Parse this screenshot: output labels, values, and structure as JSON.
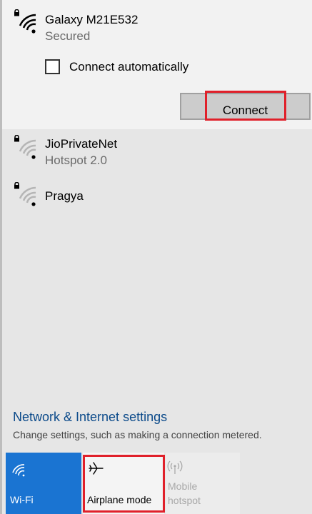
{
  "networks": [
    {
      "name": "Galaxy M21E532",
      "status": "Secured",
      "icon": "wifi-secured-icon"
    },
    {
      "name": "JioPrivateNet",
      "status": "Hotspot 2.0",
      "icon": "wifi-secured-icon"
    },
    {
      "name": "Pragya",
      "status": "",
      "icon": "wifi-secured-icon"
    }
  ],
  "connect_auto_label": "Connect automatically",
  "connect_auto_checked": false,
  "connect_button_label": "Connect",
  "settings": {
    "link": "Network & Internet settings",
    "description": "Change settings, such as making a connection metered."
  },
  "quick_actions": [
    {
      "label": "Wi-Fi",
      "icon": "wifi-icon",
      "state": "on"
    },
    {
      "label": "Airplane mode",
      "icon": "airplane-icon",
      "state": "off"
    },
    {
      "label": "Mobile hotspot",
      "icon": "hotspot-icon",
      "state": "disabled"
    }
  ],
  "colors": {
    "accent": "#1a74d2",
    "highlight": "#e0202a",
    "link": "#0b4a8a"
  }
}
